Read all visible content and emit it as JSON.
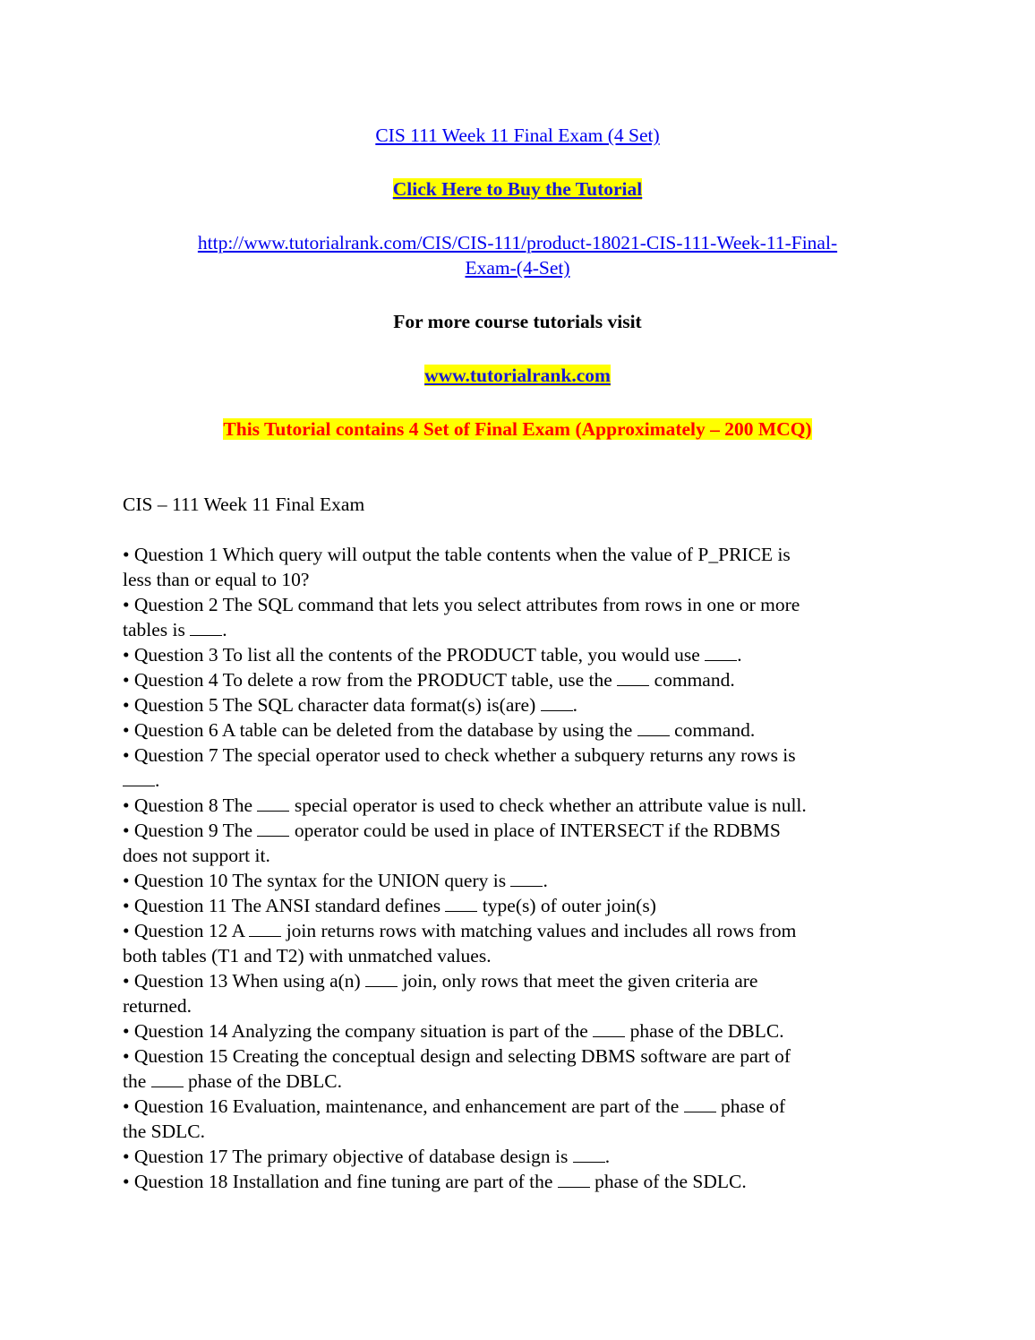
{
  "header": {
    "title_link": "CIS 111 Week 11 Final Exam (4 Set)",
    "buy_button": "Click Here to Buy the Tutorial",
    "product_url_line1": "http://www.tutorialrank.com/CIS/CIS-111/product-18021-CIS-111-Week-11-Final-",
    "product_url_line2": "Exam-(4-Set)",
    "more_tutorials": "For more course tutorials visit",
    "site_link": "www.tutorialrank.com",
    "notice": "This Tutorial contains 4 Set of Final Exam (Approximately – 200 MCQ)"
  },
  "section": {
    "heading": "CIS – 111 Week 11 Final Exam"
  },
  "colors": {
    "link": "#0000ee",
    "highlight": "#ffff00",
    "notice_text": "#ff0000"
  },
  "questions": [
    {
      "lines": [
        [
          "• Question 1 Which query will output the table contents when the value of P_PRICE is"
        ],
        [
          "less than or equal to 10?"
        ]
      ]
    },
    {
      "lines": [
        [
          "• Question 2 The SQL command that lets you select attributes from rows in one or more"
        ],
        [
          "tables is ",
          "_",
          "."
        ]
      ]
    },
    {
      "lines": [
        [
          "• Question 3 To list all the contents of the PRODUCT table, you would use ",
          "_",
          "."
        ]
      ]
    },
    {
      "lines": [
        [
          "• Question 4 To delete a row from the PRODUCT table, use the ",
          "_",
          " command."
        ]
      ]
    },
    {
      "lines": [
        [
          "• Question 5 The SQL character data format(s) is(are) ",
          "_",
          "."
        ]
      ]
    },
    {
      "lines": [
        [
          "• Question 6 A table can be deleted from the database by using the ",
          "_",
          " command."
        ]
      ]
    },
    {
      "lines": [
        [
          "• Question 7 The special operator used to check whether a subquery returns any rows is"
        ],
        [
          "_",
          "."
        ]
      ]
    },
    {
      "lines": [
        [
          "• Question 8 The ",
          "_",
          " special operator is used to check whether an attribute value is null."
        ]
      ]
    },
    {
      "lines": [
        [
          "• Question 9 The ",
          "_",
          " operator could be used in place of INTERSECT if the RDBMS"
        ],
        [
          "does not support it."
        ]
      ]
    },
    {
      "lines": [
        [
          "• Question 10 The syntax for the UNION query is ",
          "_",
          "."
        ]
      ]
    },
    {
      "lines": [
        [
          "• Question 11 The ANSI standard defines ",
          "_",
          " type(s) of outer join(s)"
        ]
      ]
    },
    {
      "lines": [
        [
          "• Question 12 A ",
          "_",
          " join returns rows with matching values and includes all rows from"
        ],
        [
          "both tables (T1 and T2) with unmatched values."
        ]
      ]
    },
    {
      "lines": [
        [
          "• Question 13 When using a(n) ",
          "_",
          " join, only rows that meet the given criteria are"
        ],
        [
          "returned."
        ]
      ]
    },
    {
      "lines": [
        [
          "• Question 14 Analyzing the company situation is part of the ",
          "_",
          " phase of the DBLC."
        ]
      ]
    },
    {
      "lines": [
        [
          "• Question 15 Creating the conceptual design and selecting DBMS software are part of"
        ],
        [
          "the ",
          "_",
          " phase of the DBLC."
        ]
      ]
    },
    {
      "lines": [
        [
          "• Question 16 Evaluation, maintenance, and enhancement are part of the ",
          "_",
          " phase of"
        ],
        [
          "the SDLC."
        ]
      ]
    },
    {
      "lines": [
        [
          "• Question 17 The primary objective of database design is ",
          "_",
          "."
        ]
      ]
    },
    {
      "lines": [
        [
          "• Question 18 Installation and fine tuning are part of the ",
          "_",
          " phase of the SDLC."
        ]
      ]
    }
  ]
}
